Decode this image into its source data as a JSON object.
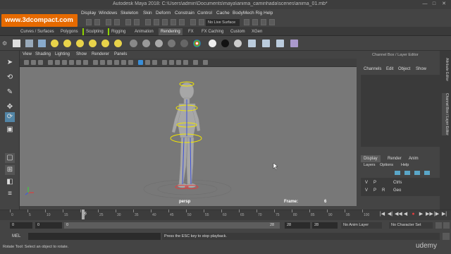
{
  "window": {
    "title": "Autodesk Maya 2018: C:\\Users\\admin\\Documents\\maya\\anima_caminhada\\scenes\\anima_01.mb*",
    "minimize": "—",
    "maximize": "□",
    "close": "✕"
  },
  "watermark": "www.3dcompact.com",
  "menubar": [
    "Display",
    "Windows",
    "Skeleton",
    "Skin",
    "Deform",
    "Constrain",
    "Control",
    "Cache",
    "BodyMech Rig",
    "Help"
  ],
  "statusline": {
    "no_live_surface": "No Live Surface"
  },
  "shelf_tabs": [
    "Curves / Surfaces",
    "Polygons",
    "Sculpting",
    "Rigging",
    "Animation",
    "Rendering",
    "FX",
    "FX Caching",
    "Custom",
    "XGen"
  ],
  "shelf_active": "Rendering",
  "panel_menu": [
    "View",
    "Shading",
    "Lighting",
    "Show",
    "Renderer",
    "Panels"
  ],
  "viewport": {
    "camera": "persp",
    "frame_label": "Frame:",
    "frame_value": "6"
  },
  "channel_box": {
    "title": "Channel Box / Layer Editor",
    "menu": [
      "Channels",
      "Edit",
      "Object",
      "Show"
    ]
  },
  "side_tabs": [
    "Attribute Editor",
    "Channel Box / Layer Editor"
  ],
  "layer_editor": {
    "tabs": [
      "Display",
      "Render",
      "Anim"
    ],
    "menu": [
      "Layers",
      "Options",
      "Help"
    ],
    "layers": [
      {
        "v": "V",
        "p": "P",
        "r": "",
        "name": "Ctrls"
      },
      {
        "v": "V",
        "p": "P",
        "r": "R",
        "name": "Geo"
      }
    ]
  },
  "timeline": {
    "ticks": [
      "0",
      "5",
      "10",
      "15",
      "20",
      "25",
      "30",
      "35",
      "40",
      "45",
      "50",
      "55",
      "60",
      "65",
      "70",
      "75",
      "80",
      "85",
      "90",
      "95",
      "100"
    ],
    "current_frame": "6",
    "playback_buttons": [
      "|◀",
      "◀|",
      "◀◀",
      "◀",
      "●",
      "▶",
      "▶▶",
      "|▶",
      "▶|"
    ]
  },
  "range": {
    "start": "0",
    "inner_start": "0",
    "slider_start": "0",
    "slider_end": "28",
    "end": "28",
    "anim_end": "28",
    "anim_layer": "No Anim Layer",
    "character_set": "No Character Set"
  },
  "command": {
    "mel_label": "MEL",
    "output": "Press the ESC key to stop playback."
  },
  "help_line": "Rotate Tool: Select an object to rotate.",
  "brand": "udemy",
  "colors": {
    "accent": "#5285a6",
    "watermark": "#e66a00",
    "viewport": "#787878",
    "rig": "#f2e600"
  }
}
